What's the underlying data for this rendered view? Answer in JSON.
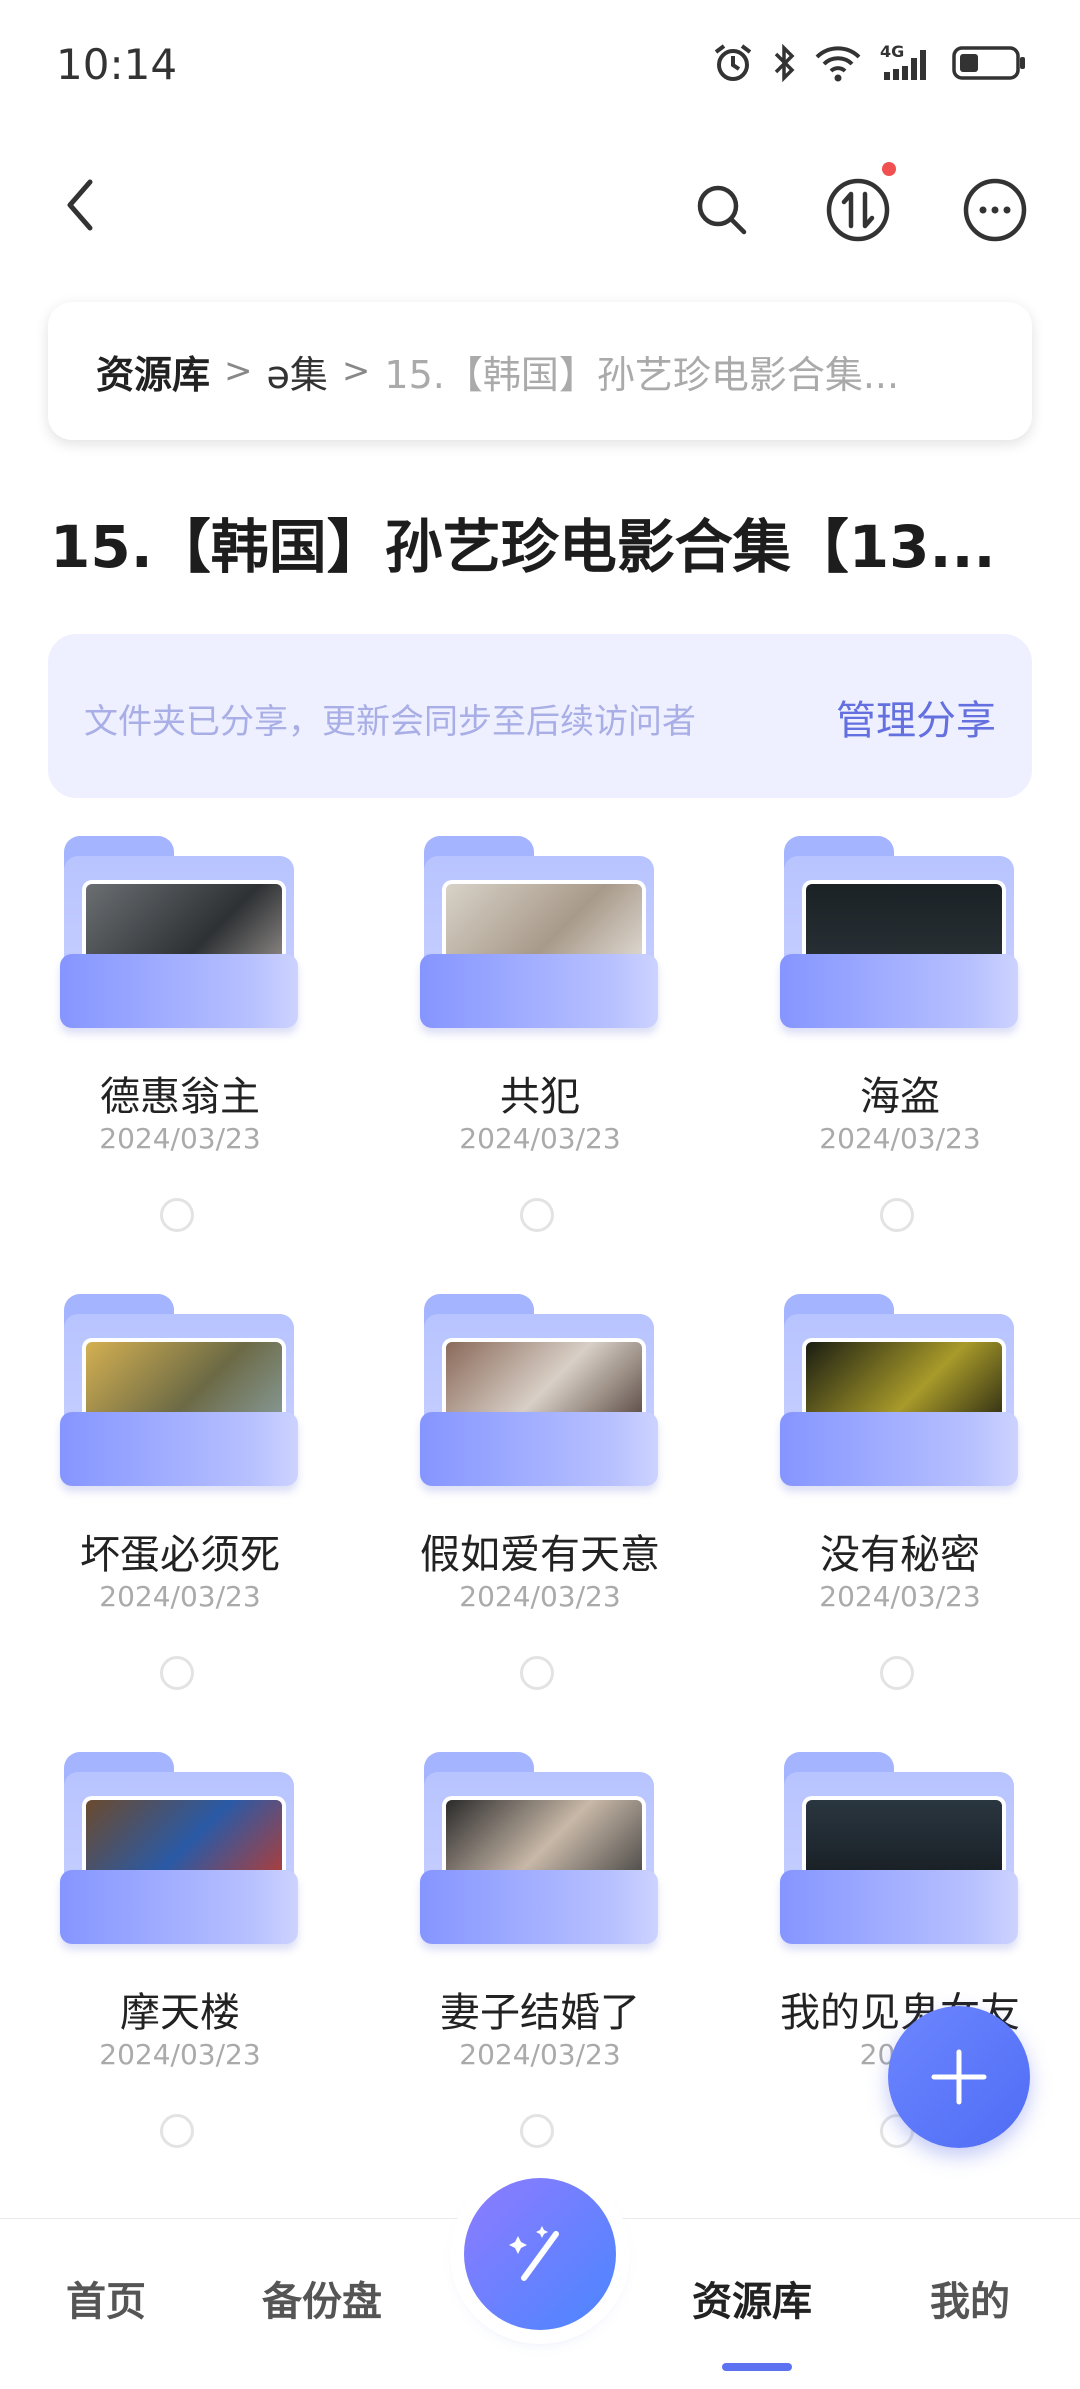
{
  "status_bar": {
    "time": "10:14",
    "icons": [
      "alarm-icon",
      "bluetooth-icon",
      "wifi-icon",
      "4g-signal-icon",
      "battery-icon"
    ],
    "network": "4G"
  },
  "breadcrumb": {
    "root": "资源库",
    "middle": "ə集",
    "current": "15.【韩国】孙艺珍电影合集..."
  },
  "page": {
    "title": "15.【韩国】孙艺珍电影合集【13..."
  },
  "share_banner": {
    "message": "文件夹已分享，更新会同步至后续访问者",
    "action": "管理分享"
  },
  "folders": [
    {
      "name": "德惠翁主",
      "date": "2024/03/23"
    },
    {
      "name": "共犯",
      "date": "2024/03/23"
    },
    {
      "name": "海盗",
      "date": "2024/03/23"
    },
    {
      "name": "坏蛋必须死",
      "date": "2024/03/23"
    },
    {
      "name": "假如爱有天意",
      "date": "2024/03/23"
    },
    {
      "name": "没有秘密",
      "date": "2024/03/23"
    },
    {
      "name": "摩天楼",
      "date": "2024/03/23"
    },
    {
      "name": "妻子结婚了",
      "date": "2024/03/23"
    },
    {
      "name": "我的见鬼女友",
      "date": "2024/"
    }
  ],
  "bottom_nav": {
    "items": [
      "首页",
      "备份盘",
      "资源库",
      "我的"
    ],
    "active": "资源库"
  },
  "colors": {
    "accent": "#5d72f0",
    "banner_bg": "#eef0ff",
    "folder": "#a4b4ff"
  }
}
